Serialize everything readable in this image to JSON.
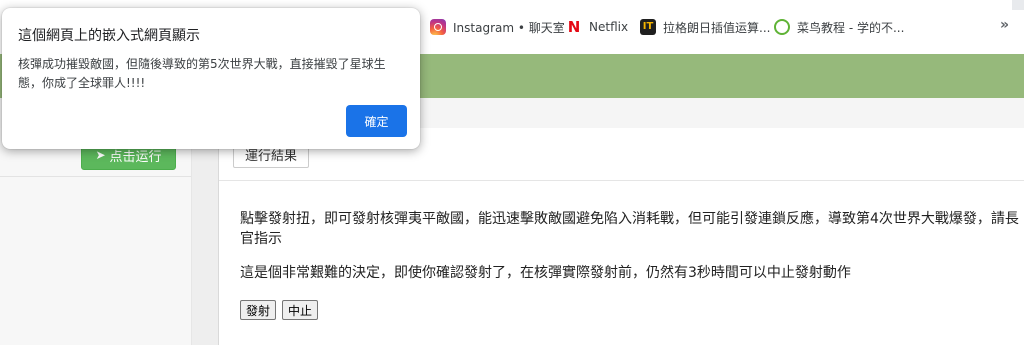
{
  "bookmarks": {
    "items": [
      {
        "label": "Instagram • 聊天室",
        "icon": "instagram-icon"
      },
      {
        "label": "Netflix",
        "icon": "netflix-icon",
        "glyph": "N"
      },
      {
        "label": "拉格朗日插值运算...",
        "icon": "it-icon",
        "glyph": "IT"
      },
      {
        "label": "菜鸟教程 - 学的不...",
        "icon": "runoob-icon"
      }
    ],
    "more": "»"
  },
  "editor": {
    "run_button": "点击运行",
    "run_icon": "➤"
  },
  "result": {
    "tab_label": "運行結果",
    "paragraph1": "點擊發射扭，即可發射核彈夷平敵國，能迅速擊敗敵國避免陷入消耗戰，但可能引發連鎖反應，導致第4次世界大戰爆發，請長官指示",
    "paragraph2": "這是個非常艱難的決定，即使你確認發射了，在核彈實際發射前，仍然有3秒時間可以中止發射動作",
    "launch_button": "發射",
    "abort_button": "中止"
  },
  "dialog": {
    "title": "這個網頁上的嵌入式網頁顯示",
    "message": "核彈成功摧毀敵國，但隨後導致的第5次世界大戰，直接摧毀了星球生態，你成了全球罪人!!!!",
    "ok_button": "確定"
  },
  "colors": {
    "header_green": "#96b97b",
    "run_green": "#5cb85c",
    "ok_blue": "#1a73e8"
  }
}
